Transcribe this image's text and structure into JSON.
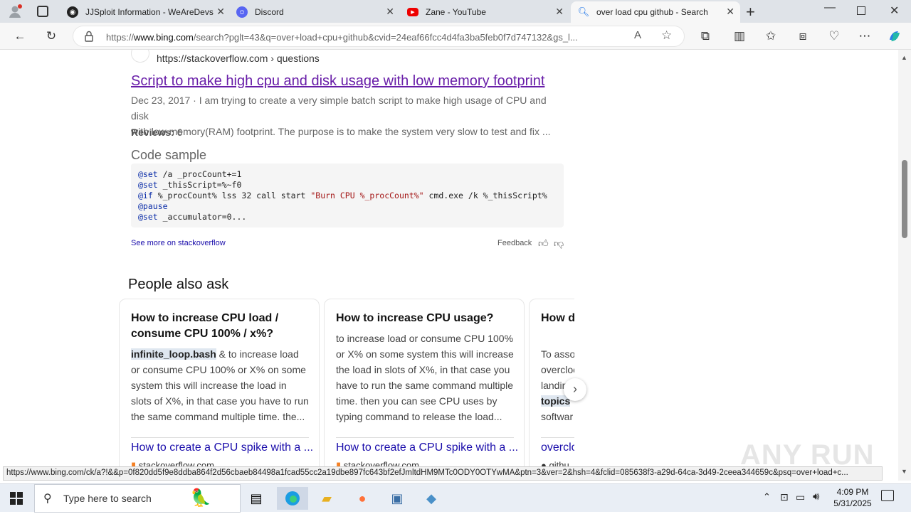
{
  "tabs": [
    {
      "label": "JJSploit Information - WeAreDevs",
      "favicon": "wearedevs-icon"
    },
    {
      "label": "Discord",
      "favicon": "discord-icon"
    },
    {
      "label": "Zane - YouTube",
      "favicon": "youtube-icon"
    },
    {
      "label": "over load cpu github - Search",
      "favicon": "bing-search-icon"
    }
  ],
  "address": {
    "scheme": "https://",
    "host": "www.bing.com",
    "path": "/search?pglt=43&q=over+load+cpu+github&cvid=24eaf66fcc4d4fa3ba5feb0f7d747132&gs_l..."
  },
  "result": {
    "source": "https://stackoverflow.com › questions",
    "title": "Script to make high cpu and disk usage with low memory footprint",
    "date": "Dec 23, 2017",
    "snippet_line1": "I am trying to create a very simple batch script to make high usage of CPU and disk",
    "snippet_line2": "with low memory(RAM) footprint. The purpose is to make the system very slow to test and fix ...",
    "reviews_label": "Reviews:",
    "reviews_value": "6",
    "code_sample_heading": "Code sample",
    "code": {
      "l1_kw": "@set",
      "l1_rest": " /a _procCount+=1",
      "l2_kw": "@set",
      "l2_rest": " _thisScript=%~f0",
      "l3_kw": "@if",
      "l3_mid": " %_procCount% lss 32 call start ",
      "l3_str": "\"Burn CPU %_procCount%\"",
      "l3_end": " cmd.exe /k %_thisScript%",
      "l4_kw": "@pause",
      "l5_kw": "@set",
      "l5_rest": " _accumulator=0..."
    },
    "see_more": "See more on stackoverflow",
    "feedback": "Feedback"
  },
  "paa": {
    "heading": "People also ask",
    "cards": [
      {
        "question": "How to increase CPU load / consume CPU 100% / x%?",
        "highlight": "infinite_loop.bash",
        "answer": " & to increase load or consume CPU 100% or X% on some system this will increase the load in slots of X%, in that case you have to run the same command multiple time. the...",
        "link": "How to create a CPU spike with a ...",
        "source": "stackoverflow.com"
      },
      {
        "question": "How to increase CPU usage?",
        "answer": "to increase load or consume CPU 100% or X% on some system this will increase the load in slots of X%, in that case you have to run the same command multiple time. then you can see CPU uses by typing command to release the load...",
        "link": "How to create a CPU spike with a ...",
        "source": "stackoverflow.com"
      },
      {
        "question": "How do... with an...",
        "answer_l1": "To asso",
        "answer_l2": "overcloc",
        "answer_l3": "landin",
        "answer_hl": "topics",
        "answer_l5": "softwar",
        "link": "overclo",
        "source": "githu"
      }
    ]
  },
  "status_url": "https://www.bing.com/ck/a?!&&p=0f820dd5f9e8ddba864f2d56cbaeb84498a1fcad55cc2a19dbe897fc643bf2efJmltdHM9MTc0ODY0OTYwMA&ptn=3&ver=2&hsh=4&fclid=085638f3-a29d-64ca-3d49-2ceea344659c&psq=over+load+c...",
  "watermark": "ANY RUN",
  "taskbar": {
    "search_placeholder": "Type here to search",
    "time": "4:09 PM",
    "date": "5/31/2025"
  },
  "colors": {
    "link": "#1a0dab",
    "visited_link": "#681da8",
    "taskbar_bg": "#e9eef5"
  }
}
